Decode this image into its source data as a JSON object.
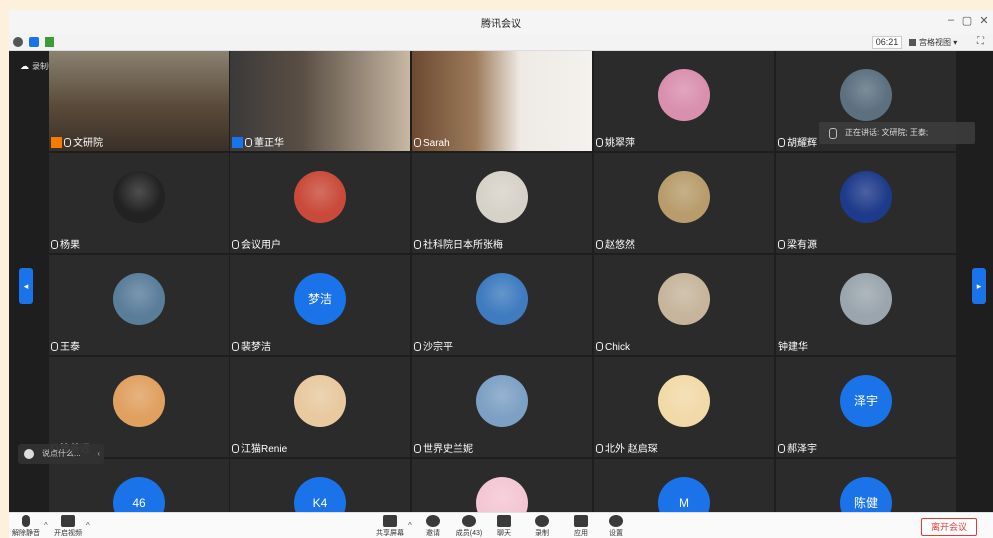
{
  "window": {
    "title": "腾讯会议",
    "minimize": "–",
    "maximize": "▢",
    "close": "✕"
  },
  "toolbar": {
    "timer": "06:21",
    "view_mode": "宫格视图 ▾",
    "fullscreen": "⛶"
  },
  "recording": "录制中",
  "speaking": "正在讲话: 文研院; 王泰;",
  "chat_placeholder": "说点什么...",
  "side_arrows": {
    "left": "◂",
    "right": "▸"
  },
  "participants": [
    {
      "name": "文研院",
      "kind": "video",
      "badge": "host"
    },
    {
      "name": "董正华",
      "kind": "video",
      "badge": "cohost"
    },
    {
      "name": "Sarah",
      "kind": "video"
    },
    {
      "name": "姚翠萍",
      "kind": "avatar",
      "color": "#d98fae"
    },
    {
      "name": "胡耀辉",
      "kind": "avatar",
      "color": "#5c7080"
    },
    {
      "name": "杨果",
      "kind": "avatar",
      "color": "#222222"
    },
    {
      "name": "会议用户",
      "kind": "avatar",
      "color": "#c94a3a"
    },
    {
      "name": "社科院日本所张梅",
      "kind": "avatar",
      "color": "#d7d2c8"
    },
    {
      "name": "赵悠然",
      "kind": "avatar",
      "color": "#b89c6c"
    },
    {
      "name": "梁有源",
      "kind": "avatar",
      "color": "#1e3a8a"
    },
    {
      "name": "王泰",
      "kind": "avatar",
      "color": "#5a7d9a",
      "mic_on": true
    },
    {
      "name": "裴梦洁",
      "kind": "text",
      "initials": "梦洁"
    },
    {
      "name": "沙宗平",
      "kind": "avatar",
      "color": "#3e7bbf"
    },
    {
      "name": "Chick",
      "kind": "avatar",
      "color": "#c6b59c"
    },
    {
      "name": "钟建华",
      "kind": "avatar",
      "color": "#9aa5ad",
      "no_mic": true
    },
    {
      "name": "管善远",
      "kind": "avatar",
      "color": "#e0a060"
    },
    {
      "name": "江猫Renie",
      "kind": "avatar",
      "color": "#e8c9a0"
    },
    {
      "name": "世界史兰妮",
      "kind": "avatar",
      "color": "#7da0c4"
    },
    {
      "name": "北外 赵启琛",
      "kind": "avatar",
      "color": "#f2d9a8"
    },
    {
      "name": "郝泽宇",
      "kind": "text",
      "initials": "泽宇"
    },
    {
      "name": "",
      "kind": "text",
      "initials": "46"
    },
    {
      "name": "",
      "kind": "text",
      "initials": "K4"
    },
    {
      "name": "",
      "kind": "avatar",
      "color": "#f4c6d4"
    },
    {
      "name": "",
      "kind": "text",
      "initials": "M"
    },
    {
      "name": "",
      "kind": "text",
      "initials": "陈健"
    }
  ],
  "bottombar": {
    "unmute": "解除静音",
    "video": "开启视频",
    "share": "共享屏幕",
    "invite": "邀请",
    "members": "成员(43)",
    "chat": "聊天",
    "record": "录制",
    "apps": "应用",
    "settings": "设置",
    "leave": "离开会议"
  }
}
